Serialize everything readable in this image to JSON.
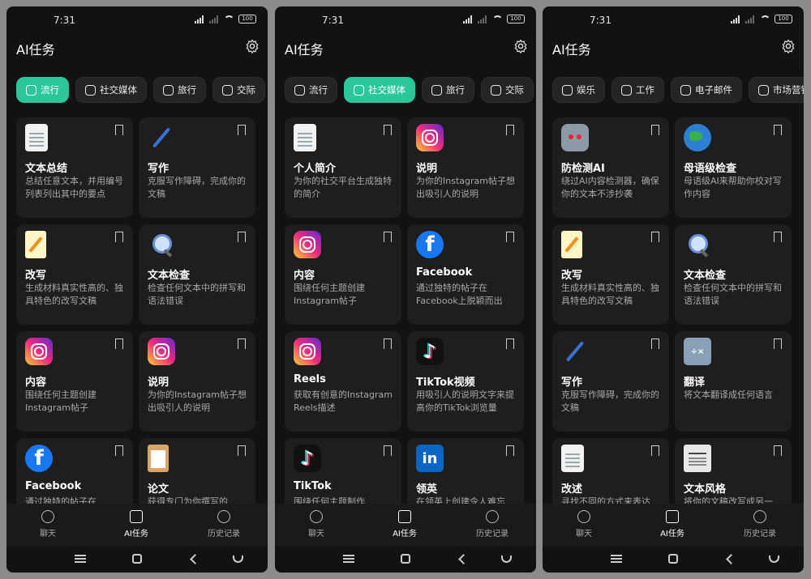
{
  "status": {
    "time": "7:31",
    "battery": "100"
  },
  "app_title": "AI任务",
  "tabs": [
    "聊天",
    "AI任务",
    "历史记录"
  ],
  "screens": [
    {
      "chips": [
        {
          "label": "流行",
          "active": true
        },
        {
          "label": "社交媒体",
          "active": false
        },
        {
          "label": "旅行",
          "active": false
        },
        {
          "label": "交际",
          "active": false
        }
      ],
      "cards": [
        {
          "icon": "document-icon",
          "title": "文本总结",
          "desc": "总结任意文本，并用编号列表列出其中的要点"
        },
        {
          "icon": "pen-icon",
          "title": "写作",
          "desc": "克服写作障碍，完成你的文稿"
        },
        {
          "icon": "memo-icon",
          "title": "改写",
          "desc": "生成材料真实性高的、独具特色的改写文稿"
        },
        {
          "icon": "magnifier-icon",
          "title": "文本检查",
          "desc": "检查任何文本中的拼写和语法错误"
        },
        {
          "icon": "instagram-icon",
          "title": "内容",
          "desc": "围绕任何主题创建Instagram帖子"
        },
        {
          "icon": "instagram-icon",
          "title": "说明",
          "desc": "为你的Instagram帖子想出吸引人的说明"
        },
        {
          "icon": "facebook-icon",
          "title": "Facebook",
          "desc": "通过独特的帖子在"
        },
        {
          "icon": "clipboard-icon",
          "title": "论文",
          "desc": "获得专门为你撰写的"
        }
      ]
    },
    {
      "chips": [
        {
          "label": "流行",
          "active": false
        },
        {
          "label": "社交媒体",
          "active": true
        },
        {
          "label": "旅行",
          "active": false
        },
        {
          "label": "交际",
          "active": false
        }
      ],
      "cards": [
        {
          "icon": "notepad-icon",
          "title": "个人简介",
          "desc": "为你的社交平台生成独特的简介"
        },
        {
          "icon": "instagram-icon",
          "title": "说明",
          "desc": "为你的Instagram帖子想出吸引人的说明"
        },
        {
          "icon": "instagram-icon",
          "title": "内容",
          "desc": "围绕任何主题创建Instagram帖子"
        },
        {
          "icon": "facebook-icon",
          "title": "Facebook",
          "desc": "通过独特的帖子在Facebook上脱颖而出"
        },
        {
          "icon": "instagram-icon",
          "title": "Reels",
          "desc": "获取有创意的Instagram Reels描述"
        },
        {
          "icon": "tiktok-icon",
          "title": "TikTok视频",
          "desc": "用吸引人的说明文字来提高你的TikTok浏览量"
        },
        {
          "icon": "tiktok-icon",
          "title": "TikTok",
          "desc": "围绕任何主题制作"
        },
        {
          "icon": "linkedin-icon",
          "title": "领英",
          "desc": "在领英上创建令人难忘"
        }
      ]
    },
    {
      "chips": [
        {
          "label": "娱乐",
          "active": false
        },
        {
          "label": "工作",
          "active": false
        },
        {
          "label": "电子邮件",
          "active": false
        },
        {
          "label": "市场营销",
          "active": false
        }
      ],
      "cards": [
        {
          "icon": "robot-icon",
          "title": "防检测AI",
          "desc": "绕过AI内容检测器，确保你的文本不涉抄袭"
        },
        {
          "icon": "globe-icon",
          "title": "母语级检查",
          "desc": "母语级AI来帮助你校对写作内容"
        },
        {
          "icon": "memo-icon",
          "title": "改写",
          "desc": "生成材料真实性高的、独具特色的改写文稿"
        },
        {
          "icon": "magnifier-icon",
          "title": "文本检查",
          "desc": "检查任何文本中的拼写和语法错误"
        },
        {
          "icon": "pen-icon",
          "title": "写作",
          "desc": "克服写作障碍，完成你的文稿"
        },
        {
          "icon": "calculator-icon",
          "title": "翻译",
          "desc": "将文本翻译成任何语言"
        },
        {
          "icon": "notepad-icon",
          "title": "改述",
          "desc": "寻找不同的方式来表达"
        },
        {
          "icon": "newspaper-icon",
          "title": "文本风格",
          "desc": "将你的文稿改写成另一"
        }
      ]
    }
  ]
}
